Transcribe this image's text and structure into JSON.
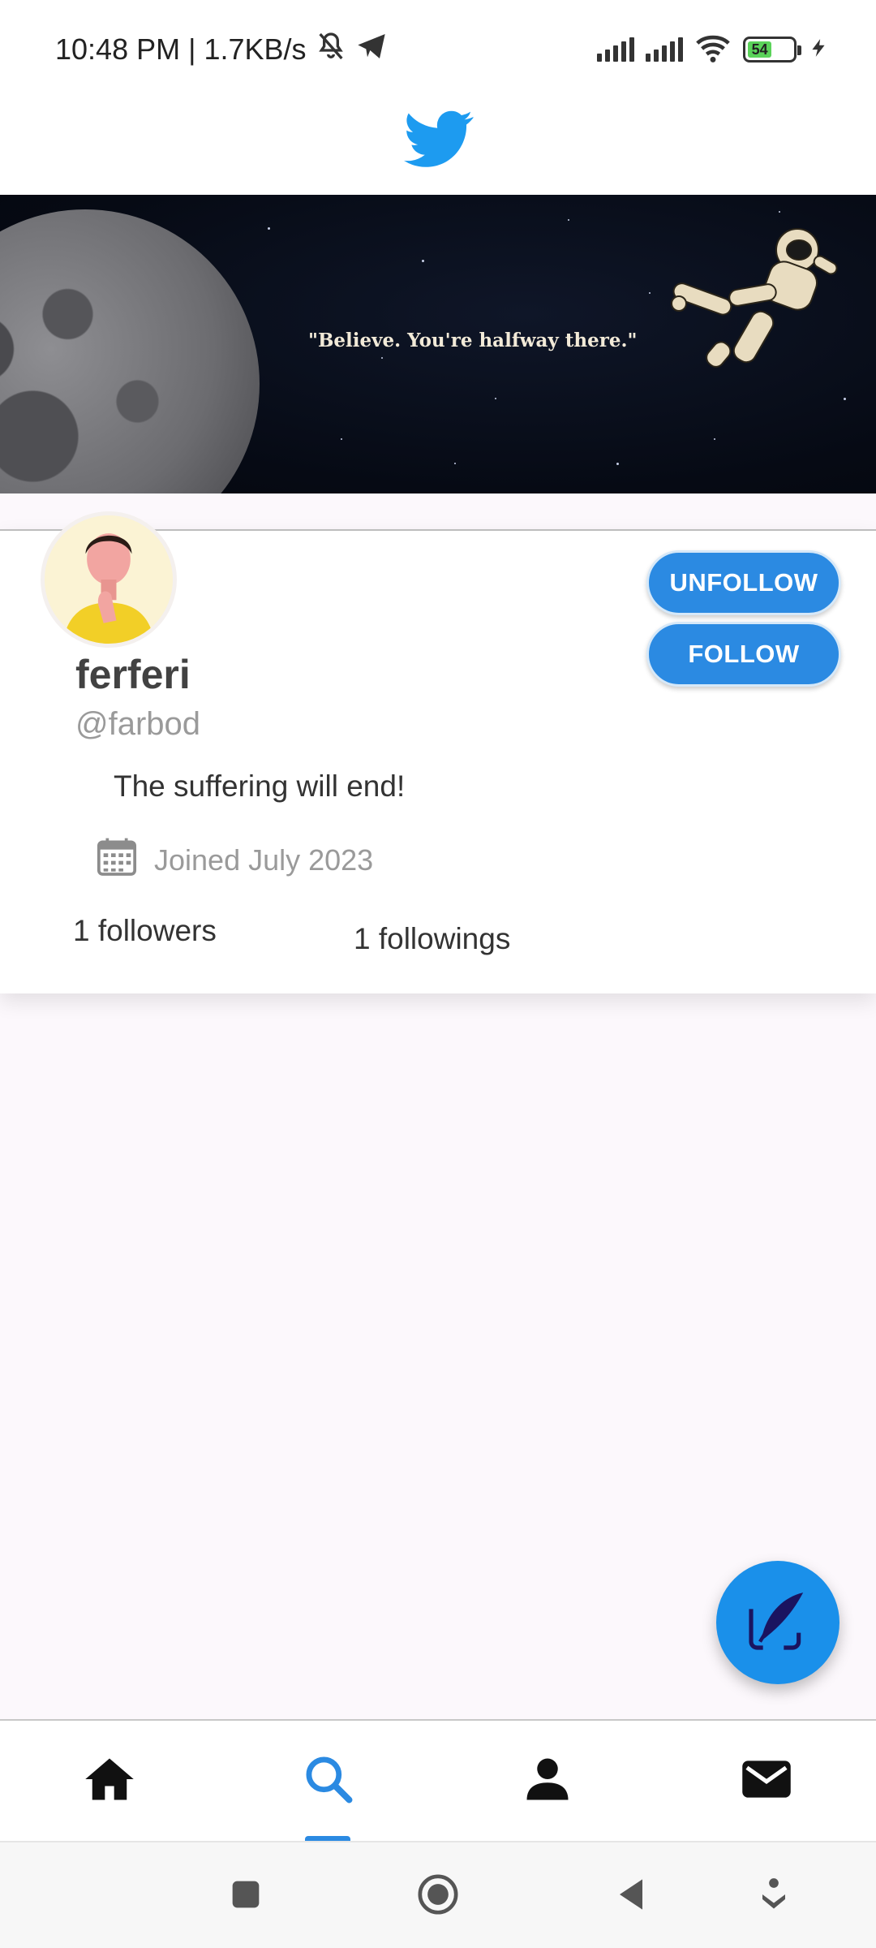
{
  "status_bar": {
    "time_speed": "10:48 PM | 1.7KB/s",
    "battery_level": "54",
    "icons": [
      "bell-off-icon",
      "telegram-icon",
      "signal-icon",
      "signal-icon",
      "wifi-icon",
      "battery-icon",
      "charging-icon"
    ]
  },
  "app_bar": {
    "logo_icon": "twitter-bird-icon"
  },
  "banner": {
    "quote": "\"Believe. You're halfway there.\""
  },
  "profile": {
    "display_name": "ferferi",
    "handle": "@farbod",
    "bio": "The suffering will end!",
    "joined": "Joined July 2023",
    "followers": "1 followers",
    "followings": "1 followings",
    "unfollow_label": "UNFOLLOW",
    "follow_label": "FOLLOW"
  },
  "fab": {
    "icon": "quill-compose-icon"
  },
  "bottom_nav": {
    "items": [
      "home-icon",
      "search-icon",
      "profile-icon",
      "mail-icon"
    ],
    "active": "search-icon"
  },
  "system_nav": {
    "items": [
      "recents-icon",
      "home-circle-icon",
      "back-icon",
      "assist-icon"
    ]
  },
  "colors": {
    "accent": "#2b8ae2",
    "fab": "#1a90ea",
    "twitter_blue": "#1d9bf0",
    "background": "#fcf8fc"
  }
}
